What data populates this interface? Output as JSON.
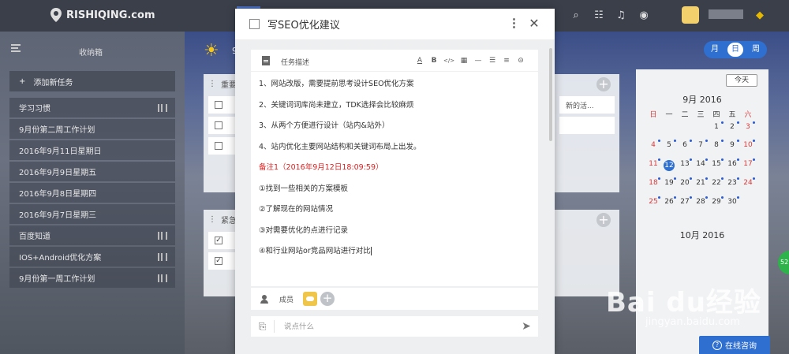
{
  "app": {
    "logo_text": "RISHIQING.com",
    "sun_text": "9"
  },
  "sidebar": {
    "title": "收纳箱",
    "add_task": "添加新任务",
    "items": [
      {
        "label": "学习习惯"
      },
      {
        "label": "9月份第二周工作计划"
      },
      {
        "label": "2016年9月11日星期日"
      },
      {
        "label": "2016年9月9日星期五"
      },
      {
        "label": "2016年9月8日星期四"
      },
      {
        "label": "2016年9月7日星期三"
      },
      {
        "label": "百度知道"
      },
      {
        "label": "IOS+Android优化方案"
      },
      {
        "label": "9月份第一周工作计划"
      }
    ]
  },
  "columns": {
    "col1_head": "重要",
    "col2_head": "紧急",
    "col3_snippet": "新的活..."
  },
  "view_switch": {
    "month": "月",
    "day": "日",
    "week": "周"
  },
  "calendar": {
    "today_label": "今天",
    "month1": "9月 2016",
    "month2": "10月 2016",
    "weekdays": [
      "日",
      "一",
      "二",
      "三",
      "四",
      "五",
      "六"
    ],
    "month1_rows": [
      [
        "",
        "",
        "",
        "",
        "1",
        "2",
        "3"
      ],
      [
        "4",
        "5",
        "6",
        "7",
        "8",
        "9",
        "10"
      ],
      [
        "11",
        "12",
        "13",
        "14",
        "15",
        "16",
        "17"
      ],
      [
        "18",
        "19",
        "20",
        "21",
        "22",
        "23",
        "24"
      ],
      [
        "25",
        "26",
        "27",
        "28",
        "29",
        "30",
        ""
      ]
    ],
    "today_day": "12"
  },
  "modal": {
    "title": "写SEO优化建议",
    "editor_label": "任务描述",
    "toolbar": {
      "color": "A",
      "bold": "B",
      "code": "</>",
      "table": "▦",
      "hr": "—",
      "ul": "☰",
      "ol": "≡",
      "link": "⊝"
    },
    "lines": [
      "1、网站改版，需要提前思考设计SEO优化方案",
      "2、关键词词库尚未建立，TDK选择会比较麻烦",
      "3、从两个方便进行设计（站内&站外）",
      "4、站内优化主要网站结构和关键词布局上出发。",
      "备注1（2016年9月12日18:09:59）",
      "①找到一些相关的方案模板",
      "②了解现在的网站情况",
      "③对需要优化的点进行记录",
      "④和行业网站or竞品网站进行对比"
    ],
    "members_label": "成员",
    "comment_placeholder": "说点什么"
  },
  "widgets": {
    "green_badge": "52",
    "consult": "在线咨询",
    "watermark_main": "Bai du经验",
    "watermark_sub": "jingyan.baidu.com"
  },
  "colors": {
    "accent": "#2f6fd0",
    "note_red": "#e02020",
    "weekend_red": "#d93a3a"
  }
}
